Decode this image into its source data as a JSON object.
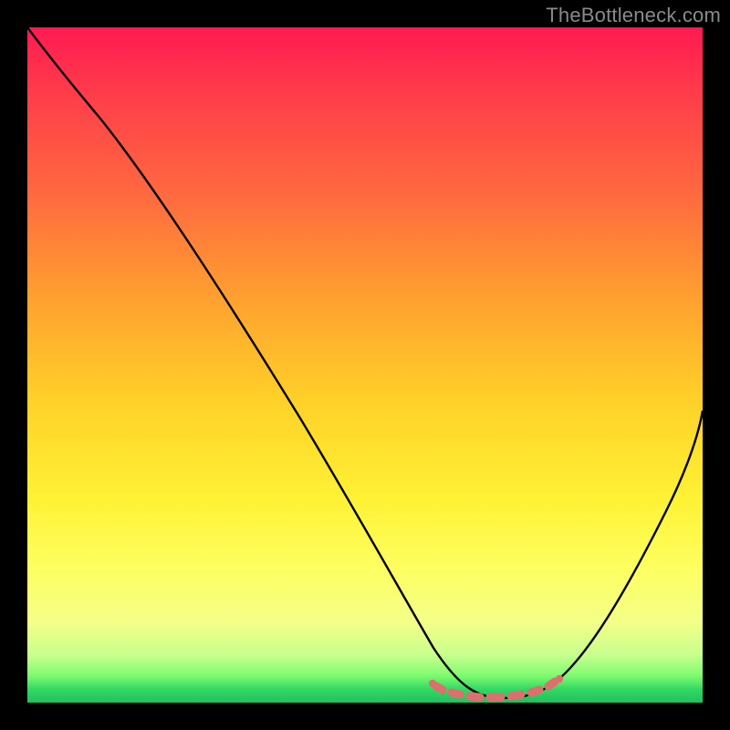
{
  "watermark": "TheBottleneck.com",
  "chart_data": {
    "type": "line",
    "title": "",
    "xlabel": "",
    "ylabel": "",
    "xlim": [
      0,
      100
    ],
    "ylim": [
      0,
      100
    ],
    "background_gradient": {
      "top_color": "#ff1a52",
      "bottom_color": "#1fc15f",
      "meaning": "red = high bottleneck, green = low bottleneck"
    },
    "series": [
      {
        "name": "bottleneck-curve",
        "color": "#000000",
        "x": [
          0,
          6,
          12,
          20,
          30,
          40,
          50,
          58,
          62,
          66,
          70,
          74,
          78,
          82,
          88,
          94,
          100
        ],
        "y": [
          100,
          93,
          86,
          76,
          62,
          48,
          33,
          20,
          11,
          4,
          1,
          1,
          2,
          6,
          17,
          32,
          48
        ]
      },
      {
        "name": "optimal-flat-segment",
        "color": "#e16a6a",
        "style": "thick-dotted",
        "x": [
          60,
          63,
          66,
          69,
          72,
          75,
          78,
          80
        ],
        "y": [
          3,
          2,
          1,
          1,
          1,
          1,
          2,
          3
        ]
      }
    ],
    "annotations": []
  }
}
